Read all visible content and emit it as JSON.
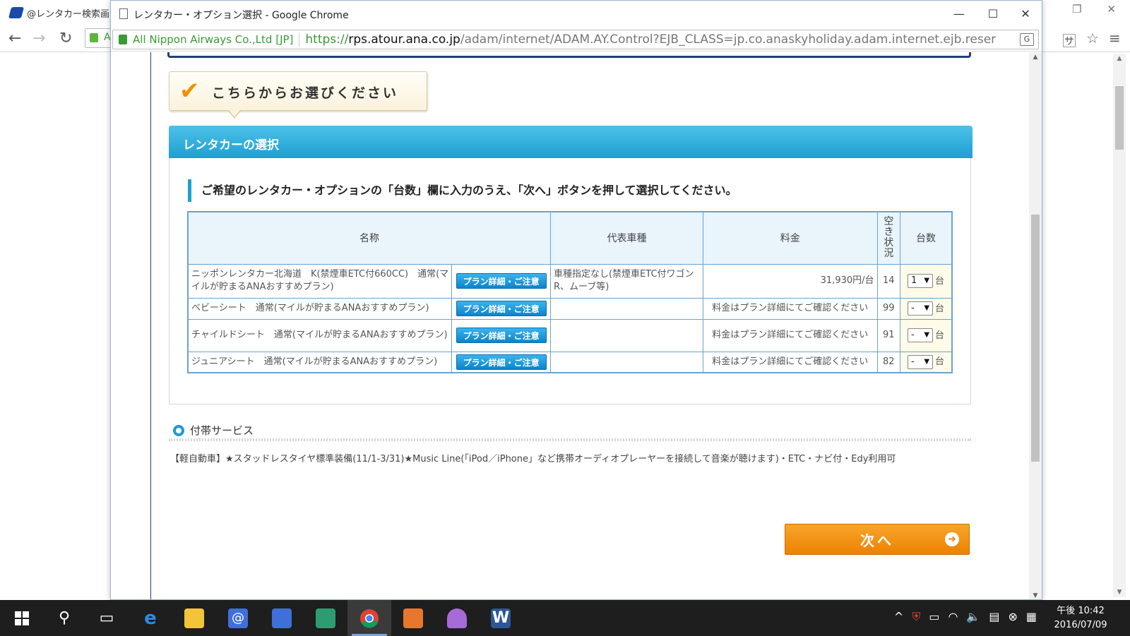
{
  "bg_window": {
    "tab_title": "@レンタカー検索画",
    "addr_fragment": "A"
  },
  "popup": {
    "title": "レンタカー・オプション選択 - Google Chrome",
    "address": {
      "org": "All Nippon Airways Co.,Ltd [JP]",
      "scheme": "https://",
      "host": "rps.atour.ana.co.jp",
      "path": "/adam/internet/ADAM.AY.Control?EJB_CLASS=jp.co.anaskyholiday.adam.internet.ejb.reser"
    }
  },
  "callout": {
    "text": "こちらからお選びください"
  },
  "panel": {
    "title": "レンタカーの選択",
    "instruction": "ご希望のレンタカー・オプションの「台数」欄に入力のうえ、「次へ」ボタンを押して選択してください。",
    "columns": {
      "name": "名称",
      "car_type": "代表車種",
      "price": "料金",
      "availability": "空き状況",
      "quantity": "台数"
    },
    "plan_button_label": "プラン詳細・ご注意",
    "unit": "台",
    "rows": [
      {
        "name": "ニッポンレンタカー北海道　K(禁煙車ETC付660CC)　通常(マイルが貯まるANAおすすめプラン)",
        "car_type": "車種指定なし(禁煙車ETC付ワゴンR、ムーブ等)",
        "price": "31,930円/台",
        "availability": "14",
        "qty": "1"
      },
      {
        "name": "ベビーシート　通常(マイルが貯まるANAおすすめプラン)",
        "car_type": "",
        "price": "料金はプラン詳細にてご確認ください",
        "availability": "99",
        "qty": "-"
      },
      {
        "name": "チャイルドシート　通常(マイルが貯まるANAおすすめプラン)",
        "car_type": "",
        "price": "料金はプラン詳細にてご確認ください",
        "availability": "91",
        "qty": "-"
      },
      {
        "name": "ジュニアシート　通常(マイルが貯まるANAおすすめプラン)",
        "car_type": "",
        "price": "料金はプラン詳細にてご確認ください",
        "availability": "82",
        "qty": "-"
      }
    ]
  },
  "aux": {
    "title": "付帯サービス",
    "note": "【軽自動車】★スタッドレスタイヤ標準装備(11/1-3/31)★Music Line(「iPod／iPhone」など携帯オーディオプレーヤーを接続して音楽が聴けます)・ETC・ナビ付・Edy利用可"
  },
  "next_button": {
    "label": "次へ"
  },
  "taskbar": {
    "clock_line1": "午後 10:42",
    "clock_line2": "2016/07/09"
  },
  "colors": {
    "panel_header": "#1f9fd1",
    "next_button": "#ed8200",
    "price_red": "#d91c1c",
    "callout_check": "#f29000"
  }
}
